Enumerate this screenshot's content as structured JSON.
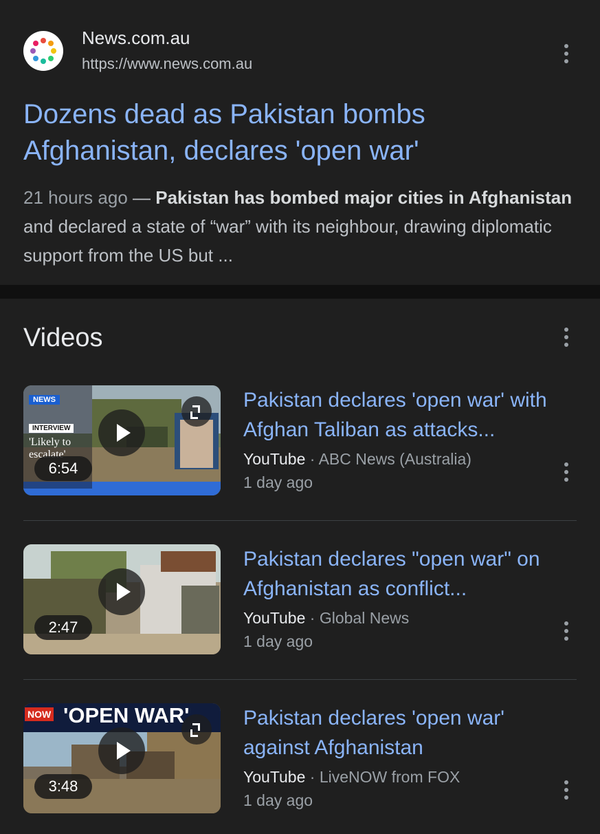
{
  "result": {
    "site_name": "News.com.au",
    "site_url": "https://www.news.com.au",
    "headline": "Dozens dead as Pakistan bombs Afghanistan, declares 'open war'",
    "date": "21 hours ago",
    "dash": " — ",
    "snippet_bold_1": "Pakistan has bombed major cities in Afghanistan",
    "snippet_rest": " and declared a state of “war” with its neighbour, drawing diplomatic support from the US but ..."
  },
  "videos": {
    "title": "Videos",
    "items": [
      {
        "title": "Pakistan declares 'open war' with Afghan Taliban as attacks...",
        "source": "YouTube",
        "separator": " · ",
        "channel": "ABC News (Australia)",
        "date": "1 day ago",
        "duration": "6:54",
        "thumb_badge": "NEWS",
        "thumb_tag": "INTERVIEW",
        "thumb_caption": "'Likely to escalate'"
      },
      {
        "title": "Pakistan declares \"open war\" on Afghanistan as conflict...",
        "source": "YouTube",
        "separator": " · ",
        "channel": "Global News",
        "date": "1 day ago",
        "duration": "2:47"
      },
      {
        "title": "Pakistan declares 'open war' against Afghanistan",
        "source": "YouTube",
        "separator": " · ",
        "channel": "LiveNOW from FOX",
        "date": "1 day ago",
        "duration": "3:48",
        "thumb_badge": "NOW",
        "thumb_caption": "'OPEN WAR'"
      }
    ]
  },
  "icons": {
    "favicon": "news-com-au-favicon-icon",
    "more": "more-vert-icon",
    "play": "play-icon",
    "expand": "expand-icon"
  },
  "colors": {
    "background": "#1f1f1f",
    "link": "#8ab4f8",
    "text": "#e8eaed",
    "muted": "#9aa0a6"
  }
}
